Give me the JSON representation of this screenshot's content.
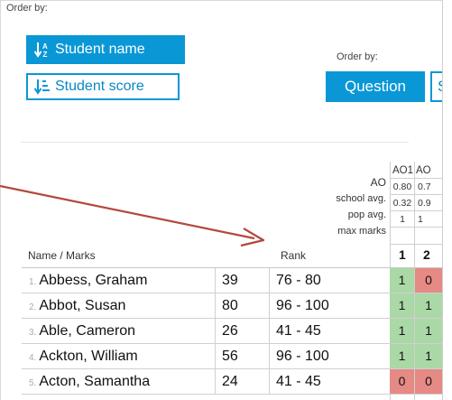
{
  "order_by_left": {
    "label": "Order by:",
    "student_name_button": "Student name",
    "student_score_button": "Student score"
  },
  "order_by_right": {
    "label": "Order by:",
    "question_button": "Question",
    "cut_button": "S"
  },
  "meta_labels": {
    "ao": "AO",
    "school_avg": "school avg.",
    "pop_avg": "pop avg.",
    "max_marks": "max marks"
  },
  "question_columns": [
    {
      "ao": "AO1",
      "school_avg": "0.80",
      "pop_avg": "0.32",
      "max_marks": "1",
      "number": "1"
    },
    {
      "ao": "AO",
      "school_avg": "0.7",
      "pop_avg": "0.9",
      "max_marks": "1",
      "number": "2"
    }
  ],
  "table_headers": {
    "name": "Name / Marks",
    "rank": "Rank"
  },
  "students": [
    {
      "index": "1.",
      "name": "Abbess, Graham",
      "score": "39",
      "rank": "76 - 80",
      "marks": [
        "1",
        "0"
      ],
      "status": [
        "correct",
        "incorrect"
      ]
    },
    {
      "index": "2.",
      "name": "Abbot, Susan",
      "score": "80",
      "rank": "96 - 100",
      "marks": [
        "1",
        "1"
      ],
      "status": [
        "correct",
        "correct"
      ]
    },
    {
      "index": "3.",
      "name": "Able, Cameron",
      "score": "26",
      "rank": "41 - 45",
      "marks": [
        "1",
        "1"
      ],
      "status": [
        "correct",
        "correct"
      ]
    },
    {
      "index": "4.",
      "name": "Ackton, William",
      "score": "56",
      "rank": "96 - 100",
      "marks": [
        "1",
        "1"
      ],
      "status": [
        "correct",
        "correct"
      ]
    },
    {
      "index": "5.",
      "name": "Acton, Samantha",
      "score": "24",
      "rank": "41 - 45",
      "marks": [
        "0",
        "0"
      ],
      "status": [
        "incorrect",
        "incorrect"
      ]
    }
  ],
  "colors": {
    "accent": "#0a97d6",
    "correct": "#aad8a6",
    "incorrect": "#e58a84",
    "annotation_arrow": "#b5473e"
  }
}
